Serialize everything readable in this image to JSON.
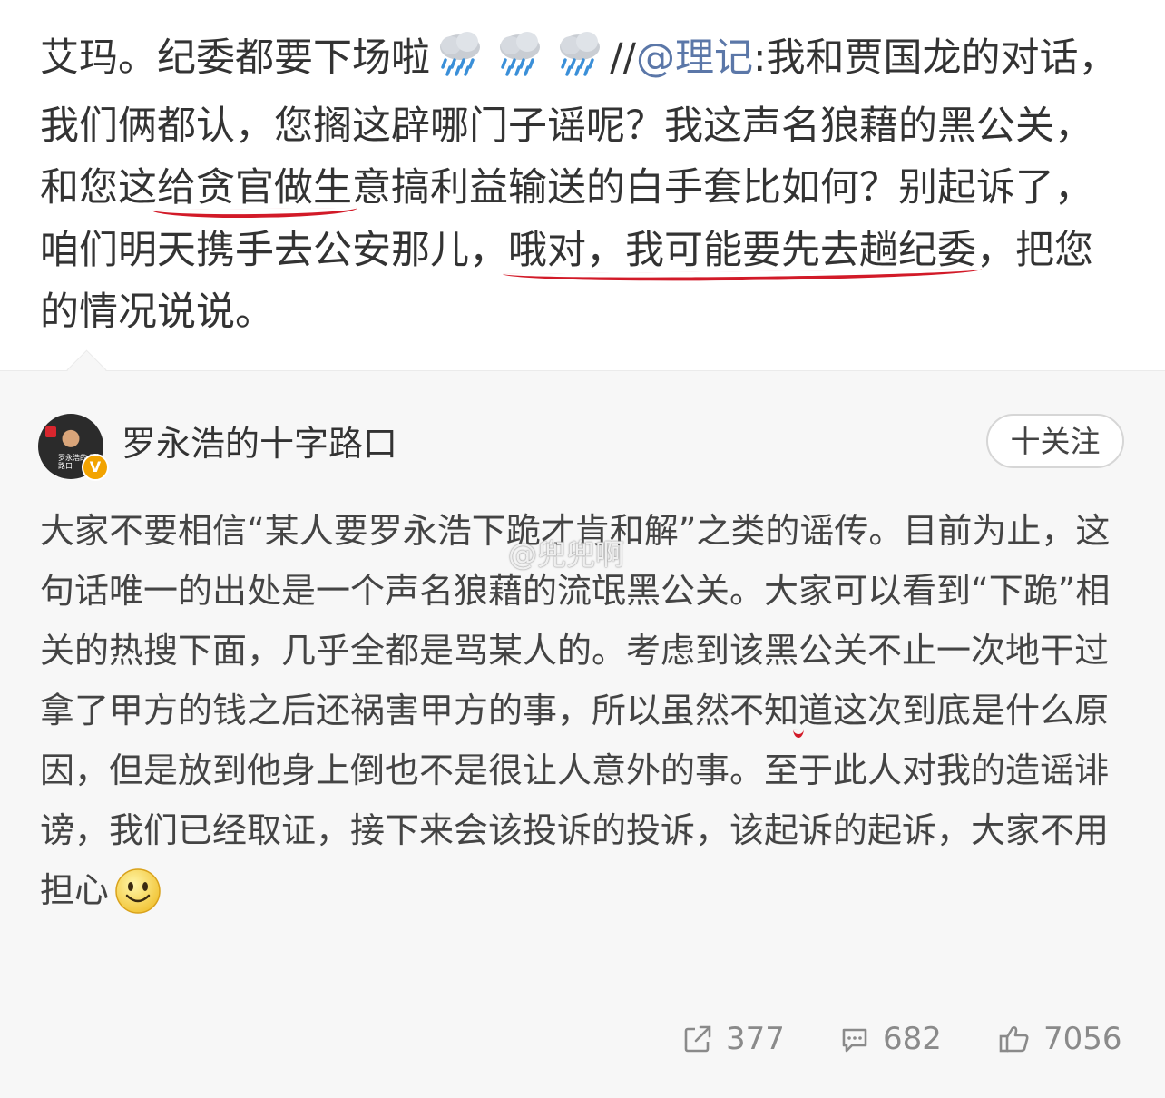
{
  "post": {
    "text_a": "艾玛。纪委都要下场啦",
    "text_b": "//",
    "mention": "@理记",
    "text_c": ":我和贾国龙的对话，我们俩都认，您搁这辟哪门子谣呢？我这声名狼藉的黑公关，和您这",
    "ul_1": "给贪官做生",
    "text_d": "意搞利益输送的白手套比如何？别起诉了，咱们明天携手去公安那儿，",
    "ul_2": "哦对，我可能要先去趟纪委",
    "text_e": "，把您的情况说说。"
  },
  "repost": {
    "author_name": "罗永浩的十字路口",
    "avatar_caption": "罗永浩的十字路口",
    "verified_badge": "V",
    "follow_label": "十关注",
    "text_a": "大家不要相信“某人要罗永浩下跪才肯和解”之类的谣传。目前为止，这句话唯一的出处是一个声名狼藉的流氓黑公关。大家可以看到“下跪”相关的热搜下面，几乎全都是骂某人的。考虑到该黑",
    "ul_1": "公关不止一次地干过拿了甲方的钱之后还祸害甲方的事",
    "text_b": "，所以虽然不知道这次到底是什么原因，但是放到他身上倒也不是很让人意外的事。至于此人对我的造谣诽谤，我们已经取证，接下来会该投诉的投诉，该起诉的起诉，大家不用担心",
    "watermark": "@兜兜啊"
  },
  "stats": {
    "reposts": "377",
    "comments": "682",
    "likes": "7056"
  },
  "icons": {
    "emoji_rain": "rain-cloud-icon",
    "emoji_smile": "smile-icon",
    "repost": "share-arrow-icon",
    "comment": "comment-bubble-icon",
    "like": "thumbs-up-icon"
  },
  "colors": {
    "mention": "#5b77a8",
    "underline": "#d21a28",
    "card_bg": "#f7f7f7",
    "badge": "#f2a300"
  }
}
